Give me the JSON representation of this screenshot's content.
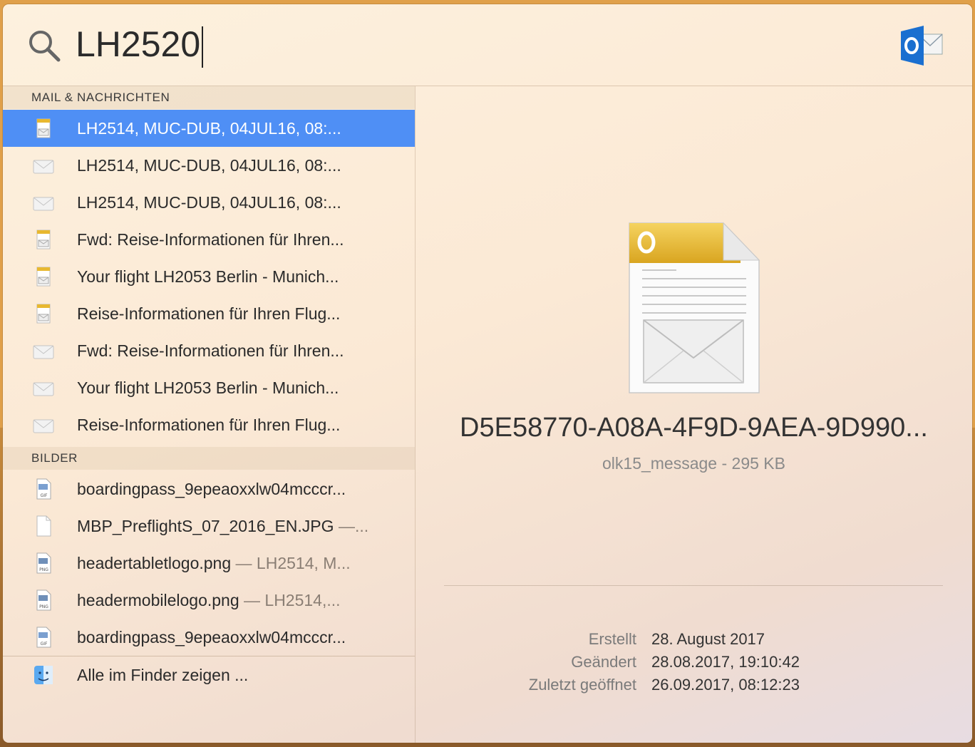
{
  "search": {
    "query": "LH2520"
  },
  "sections": {
    "mail": {
      "header": "MAIL & NACHRICHTEN",
      "items": [
        {
          "label": "LH2514, MUC-DUB, 04JUL16, 08:...",
          "icon": "outlook-message-doc-icon",
          "selected": true
        },
        {
          "label": "LH2514, MUC-DUB, 04JUL16, 08:...",
          "icon": "envelope-icon"
        },
        {
          "label": "LH2514, MUC-DUB, 04JUL16, 08:...",
          "icon": "envelope-icon"
        },
        {
          "label": "Fwd: Reise-Informationen für Ihren...",
          "icon": "outlook-message-doc-icon"
        },
        {
          "label": "Your flight LH2053 Berlin - Munich...",
          "icon": "outlook-message-doc-icon"
        },
        {
          "label": "Reise-Informationen für Ihren Flug...",
          "icon": "outlook-message-doc-icon"
        },
        {
          "label": "Fwd: Reise-Informationen für Ihren...",
          "icon": "envelope-icon"
        },
        {
          "label": "Your flight LH2053 Berlin - Munich...",
          "icon": "envelope-icon"
        },
        {
          "label": "Reise-Informationen für Ihren Flug...",
          "icon": "envelope-icon"
        }
      ]
    },
    "images": {
      "header": "BILDER",
      "items": [
        {
          "label": "boardingpass_9epeaoxxlw04mcccr...",
          "sub": "",
          "icon": "gif-file-icon",
          "badge": "GIF"
        },
        {
          "label": "MBP_PreflightS_07_2016_EN.JPG",
          "sub": "—...",
          "icon": "blank-file-icon",
          "badge": ""
        },
        {
          "label": "headertabletlogo.png",
          "sub": "— LH2514, M...",
          "icon": "png-file-icon",
          "badge": "PNG"
        },
        {
          "label": "headermobilelogo.png",
          "sub": "— LH2514,...",
          "icon": "png-file-icon",
          "badge": "PNG"
        },
        {
          "label": "boardingpass_9epeaoxxlw04mcccr...",
          "sub": "",
          "icon": "gif-file-icon",
          "badge": "GIF"
        }
      ]
    },
    "finder": {
      "label": "Alle im Finder zeigen ...",
      "icon": "finder-icon"
    }
  },
  "preview": {
    "title": "D5E58770-A08A-4F9D-9AEA-9D990...",
    "subtitle": "olk15_message - 295 KB",
    "doc_icon_letter": "O",
    "meta": [
      {
        "key": "Erstellt",
        "value": "28. August 2017"
      },
      {
        "key": "Geändert",
        "value": "28.08.2017, 19:10:42"
      },
      {
        "key": "Zuletzt geöffnet",
        "value": "26.09.2017, 08:12:23"
      }
    ]
  },
  "colors": {
    "selection": "#4f8ff5",
    "outlook_blue": "#1a6fd0",
    "doc_gold": "#e8b830"
  }
}
